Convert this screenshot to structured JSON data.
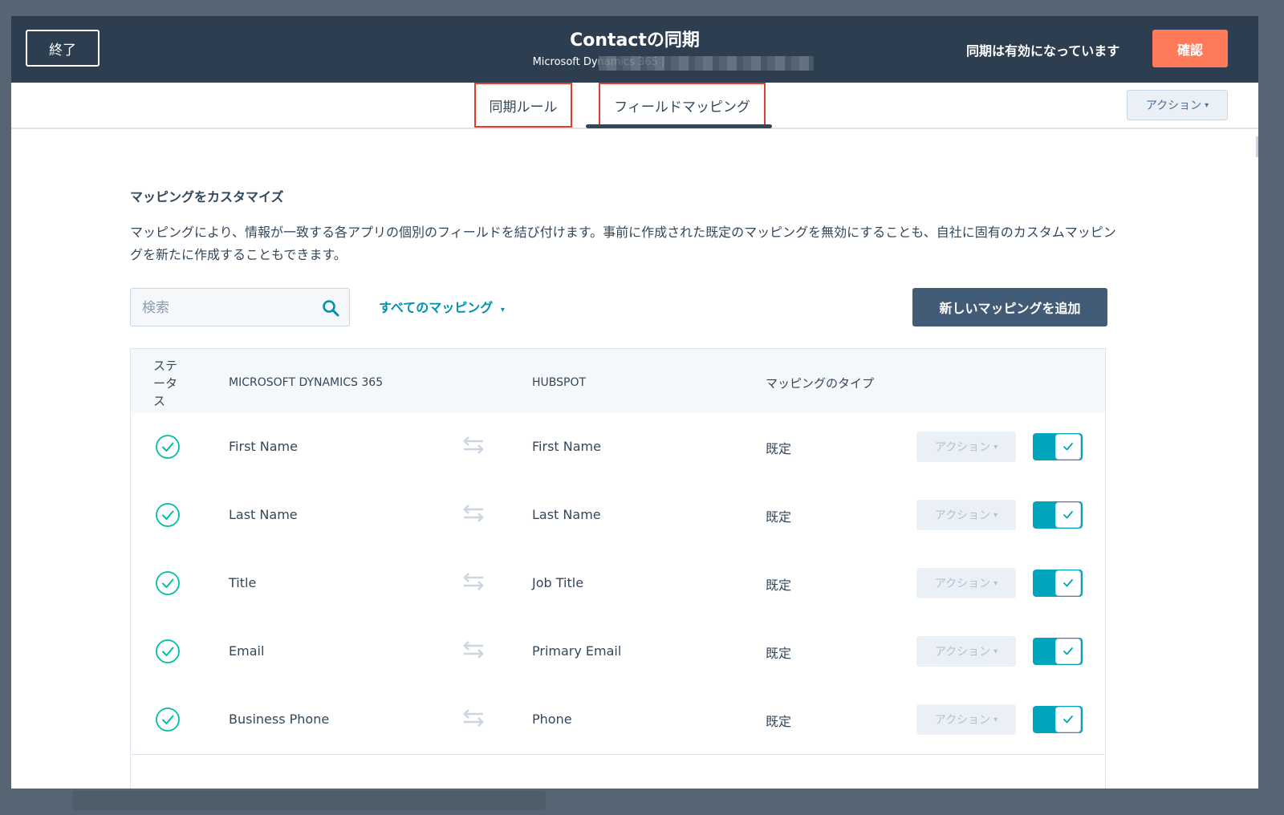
{
  "header": {
    "exit_label": "終了",
    "title": "Contactの同期",
    "subtitle": "Microsoft Dynamics 365 |",
    "status_text": "同期は有効になっています",
    "confirm_label": "確認"
  },
  "tabs": [
    {
      "label": "同期ルール"
    },
    {
      "label": "フィールドマッピング"
    }
  ],
  "tab_actions_label": "アクション",
  "section": {
    "title": "マッピングをカスタマイズ",
    "description": "マッピングにより、情報が一致する各アプリの個別のフィールドを結び付けます。事前に作成された既定のマッピングを無効にすることも、自社に固有のカスタムマッピングを新たに作成することもできます。"
  },
  "search": {
    "placeholder": "検索"
  },
  "filter_label": "すべてのマッピング",
  "add_button_label": "新しいマッピングを追加",
  "table": {
    "headers": {
      "status": "ステータス",
      "ms": "MICROSOFT DYNAMICS 365",
      "hubspot": "HUBSPOT",
      "type": "マッピングのタイプ"
    },
    "rows": [
      {
        "ms": "First Name",
        "hubspot": "First Name",
        "type": "既定",
        "actions": "アクション",
        "enabled": true
      },
      {
        "ms": "Last Name",
        "hubspot": "Last Name",
        "type": "既定",
        "actions": "アクション",
        "enabled": true
      },
      {
        "ms": "Title",
        "hubspot": "Job Title",
        "type": "既定",
        "actions": "アクション",
        "enabled": true
      },
      {
        "ms": "Email",
        "hubspot": "Primary Email",
        "type": "既定",
        "actions": "アクション",
        "enabled": true
      },
      {
        "ms": "Business Phone",
        "hubspot": "Phone",
        "type": "既定",
        "actions": "アクション",
        "enabled": true
      }
    ]
  },
  "colors": {
    "header_bg": "#2d3e50",
    "confirm_accent": "#ff7a59",
    "link": "#0091ae",
    "toggle_on": "#00a4bd",
    "highlight_box": "#e03c31",
    "status_ok": "#00bda5"
  }
}
